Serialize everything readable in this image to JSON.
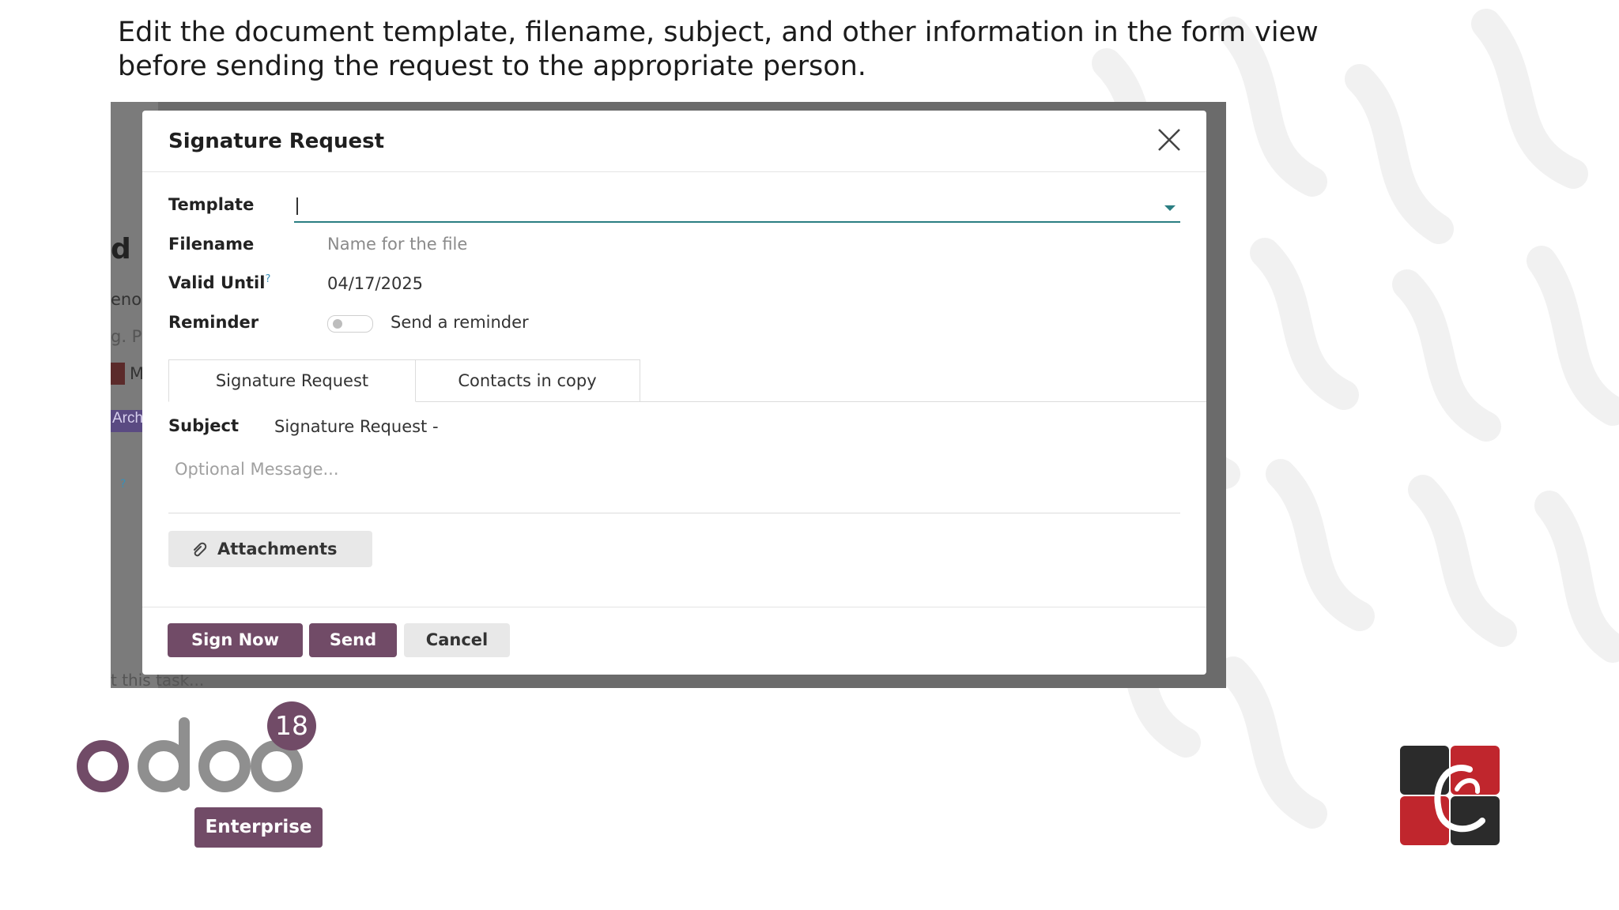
{
  "caption": "Edit the document template, filename, subject, and other information in the form view before sending the request to the appropriate person.",
  "background_fragments": {
    "frag1": "d",
    "frag2": "eno",
    "frag3": "g. P",
    "frag4": "M",
    "tag": "Arch",
    "help": "?",
    "bottom": "t this task..."
  },
  "dialog": {
    "title": "Signature Request",
    "fields": {
      "template_label": "Template",
      "template_value": "",
      "filename_label": "Filename",
      "filename_placeholder": "Name for the file",
      "valid_until_label": "Valid Until",
      "valid_until_help": "?",
      "valid_until_value": "04/17/2025",
      "reminder_label": "Reminder",
      "reminder_text": "Send a reminder",
      "reminder_enabled": false
    },
    "tabs": [
      {
        "label": "Signature Request",
        "active": true
      },
      {
        "label": "Contacts in copy",
        "active": false
      }
    ],
    "subject_label": "Subject",
    "subject_value": "Signature Request -",
    "message_placeholder": "Optional Message...",
    "attachments_label": "Attachments",
    "buttons": {
      "sign_now": "Sign Now",
      "send": "Send",
      "cancel": "Cancel"
    }
  },
  "branding": {
    "version": "18",
    "edition": "Enterprise",
    "primary_color": "#714b67"
  }
}
